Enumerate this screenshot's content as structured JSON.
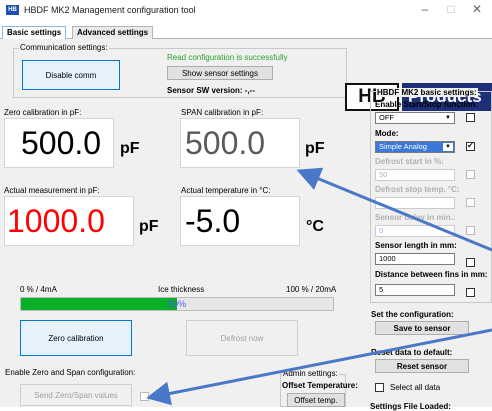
{
  "window": {
    "title": "HBDF MK2 Management configuration tool",
    "icon_text": "HB",
    "minimize": "–",
    "maximize": "□",
    "close": "✕"
  },
  "tabs": [
    {
      "label": "Basic settings",
      "active": true
    },
    {
      "label": "Advanced settings",
      "active": false
    }
  ],
  "communication": {
    "group_label": "Communication settings:",
    "disable_label": "Disable comm",
    "status_text": "Read configuration is successfully",
    "status_color": "#2aa02a",
    "show_sensor_label": "Show sensor settings",
    "sw_version_label": "Sensor SW version: -,--"
  },
  "logo": {
    "left": "HB",
    "right": "Products"
  },
  "zero_cal": {
    "label": "Zero calibration in pF:",
    "value": "500.0",
    "unit": "pF"
  },
  "span_cal": {
    "label": "SPAN calibration in pF:",
    "value": "500.0",
    "unit": "pF"
  },
  "actual": {
    "label": "Actual measurement in pF:",
    "value": "1000.0",
    "unit": "pF",
    "color": "#ff0000"
  },
  "temperature": {
    "label": "Actual temperature in °C:",
    "value": "-5.0",
    "unit": "°C"
  },
  "ice": {
    "left_label": "0 % / 4mA",
    "center_label": "Ice thickness",
    "right_label": "100 % / 20mA",
    "percent": 50,
    "percent_text": "50%"
  },
  "buttons": {
    "zero_calibration": "Zero calibration",
    "defrost_now": "Defrost now",
    "send_zero_span": "Send Zero/Span values"
  },
  "zero_span_group": {
    "label": "Enable Zero and Span configuration:"
  },
  "admin": {
    "group_label": "Admin settings:",
    "offset_label": "Offset Temperature:",
    "offset_button": "Offset temp."
  },
  "basic_settings": {
    "group_label": "HBDF MK2 basic settings:",
    "start_stop_label": "Enable Start/Stop function:",
    "start_stop_value": "OFF",
    "mode_label": "Mode:",
    "mode_value": "Simple Analog",
    "defrost_start_label": "Defrost start in %:",
    "defrost_start_value": "50",
    "defrost_stop_label": "Defrost stop temp. °C:",
    "defrost_stop_value": "",
    "sensor_delay_label": "Sensor delay in min.:",
    "sensor_delay_value": "0",
    "sensor_length_label": "Sensor length in mm:",
    "sensor_length_value": "1000",
    "fin_distance_label": "Distance between fins in mm:",
    "fin_distance_value": "5"
  },
  "set_config": {
    "label": "Set the configuration:",
    "button": "Save to sensor"
  },
  "reset": {
    "label": "Reset data to default:",
    "button": "Reset sensor",
    "select_all": "Select all data"
  },
  "bottom_cut": {
    "label": "Settings File Loaded:"
  }
}
